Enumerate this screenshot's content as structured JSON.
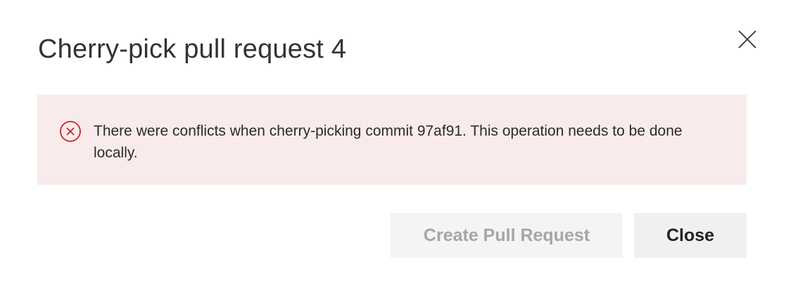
{
  "dialog": {
    "title": "Cherry-pick pull request 4",
    "close_icon": "close-icon"
  },
  "error": {
    "icon": "error-circle-icon",
    "message": "There were conflicts when cherry-picking commit 97af91. This operation needs to be done locally.",
    "background_color": "#f9ebeb",
    "icon_color": "#c4262e"
  },
  "buttons": {
    "create_pr_label": "Create Pull Request",
    "create_pr_disabled": true,
    "close_label": "Close"
  }
}
